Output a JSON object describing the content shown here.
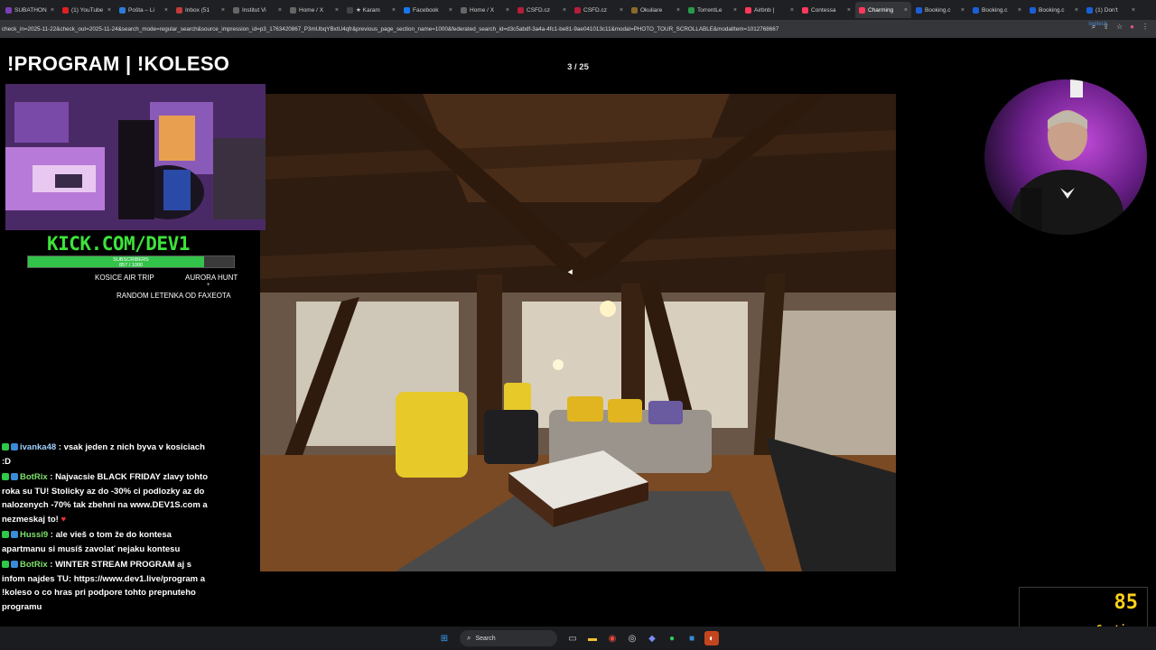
{
  "browser": {
    "tabs": [
      {
        "label": "SUBATHON",
        "color": "#7b3fb8"
      },
      {
        "label": "(1) YouTube",
        "color": "#e02020"
      },
      {
        "label": "Pošta – Li",
        "color": "#2b7bd8"
      },
      {
        "label": "Inbox (51",
        "color": "#c23a3a"
      },
      {
        "label": "Institut Vi",
        "color": "#666666"
      },
      {
        "label": "Home / X",
        "color": "#666666"
      },
      {
        "label": "★ Karam",
        "color": "#444444"
      },
      {
        "label": "Facebook",
        "color": "#1877f2"
      },
      {
        "label": "Home / X",
        "color": "#666666"
      },
      {
        "label": "ČSFD.cz",
        "color": "#b51e3a"
      },
      {
        "label": "ČSFD.cz",
        "color": "#b51e3a"
      },
      {
        "label": "Okuliare",
        "color": "#8a6a2a"
      },
      {
        "label": "TorrentLe",
        "color": "#2a9a4a"
      },
      {
        "label": "Airbnb | ",
        "color": "#ff385c"
      },
      {
        "label": "Contessa",
        "color": "#ff385c"
      },
      {
        "label": "Charming",
        "color": "#ff385c",
        "active": true
      },
      {
        "label": "Booking.c",
        "color": "#1a5fd8"
      },
      {
        "label": "Booking.c",
        "color": "#1a5fd8"
      },
      {
        "label": "Booking.c",
        "color": "#1a5fd8"
      },
      {
        "label": "(1) Don't",
        "color": "#1a5fd8"
      }
    ],
    "url": "check_in=2025-11-22&check_out=2025-11-24&search_mode=regular_search&source_impression_id=p3_1763420867_P3mUbqYBxtU4qfr&previous_page_section_name=1000&federated_search_id=d3c5abdf-3a4a-4fc1-be81-9ae041013c11&modal=PHOTO_TOUR_SCROLLABLE&modalItem=1012768667",
    "logi_label": "logitech"
  },
  "photo_tour": {
    "counter": "3 / 25"
  },
  "stream": {
    "title": "!PROGRAM | !KOLESO",
    "kick_handle": "KICK.COM/DEV1",
    "subs_label": "SUBSCRIBERS",
    "subs_count": "857 / 1000",
    "subs_progress": 0.857,
    "goal_left": "KOSICE AIR TRIP",
    "goal_right": "AURORA HUNT",
    "goal_plus": "+",
    "goal_bottom": "RANDOM LETENKA OD FAXEOTA"
  },
  "chat": [
    {
      "user": "ivanka48",
      "user_color": "#9fd0ff",
      "text": " : vsak jeden z nich byva v kosiciach :D",
      "heart": false
    },
    {
      "user": "BotRix",
      "user_color": "#7ee06a",
      "text": " : Najvacsie BLACK FRIDAY zlavy tohto roka su TU! Stolicky az do -30% ci podlozky az do nalozenych -70% tak zbehni na www.DEV1S.com a nezmeskaj to! ",
      "heart": true
    },
    {
      "user": "Hussi9",
      "user_color": "#7ee06a",
      "text": " : ale vieš o tom že do kontesa apartmanu si musíš zavolať nejaku kontesu",
      "heart": false
    },
    {
      "user": "BotRix",
      "user_color": "#7ee06a",
      "text": " : WINTER STREAM PROGRAM aj s infom najdes TU: https://www.dev1.live/program a !koleso o co hras pri podpore tohto prepnuteho programu",
      "heart": false
    }
  ],
  "caution_widget": {
    "value": "85",
    "label": "Caution"
  },
  "taskbar": {
    "search_placeholder": "Search"
  }
}
